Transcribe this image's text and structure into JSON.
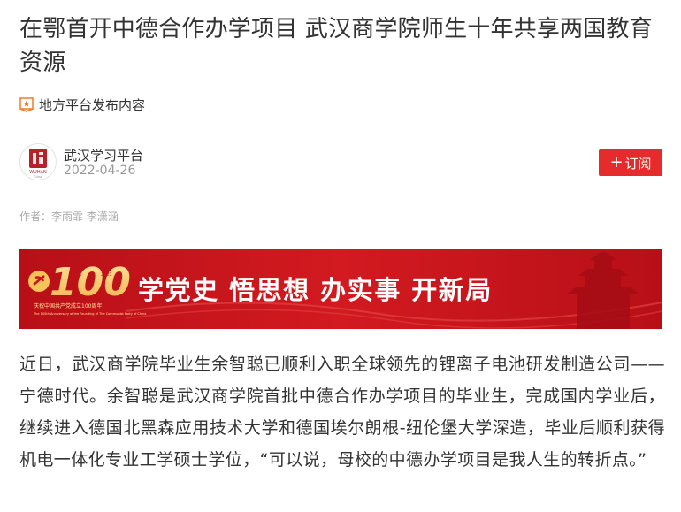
{
  "article": {
    "title": "在鄂首开中德合作办学项目 武汉商学院师生十年共享两国教育资源",
    "source_label": "地方平台发布内容",
    "account_name": "武汉学习平台",
    "publish_date": "2022-04-26",
    "subscribe_label": "订阅",
    "author_line": "作者：李雨霏 李潇涵",
    "paragraph": "近日，武汉商学院毕业生余智聪已顺利入职全球领先的锂离子电池研发制造公司——宁德时代。余智聪是武汉商学院首批中德合作办学项目的毕业生，完成国内学业后，继续进入德国北黑森应用技术大学和德国埃尔朗根-纽伦堡大学深造，毕业后顺利获得机电一体化专业工学硕士学位，“可以说，母校的中德办学项目是我人生的转折点。”"
  },
  "avatar": {
    "logo_text": "WUHAN",
    "logo_subtext": "China"
  },
  "banner": {
    "slogan": "学党史 悟思想 办实事 开新局",
    "emblem_number": "100",
    "emblem_year_left": "1921",
    "emblem_year_right": "2021",
    "emblem_caption": "庆祝中国共产党成立100周年",
    "emblem_caption_en": "The 100th Anniversary of the Founding of The Communist Party of China"
  },
  "colors": {
    "accent": "#e52b2b",
    "banner_red": "#c8141c",
    "text": "#333333",
    "muted": "#999999"
  },
  "icons": {
    "source": "badge-star-icon",
    "subscribe": "plus-icon"
  }
}
